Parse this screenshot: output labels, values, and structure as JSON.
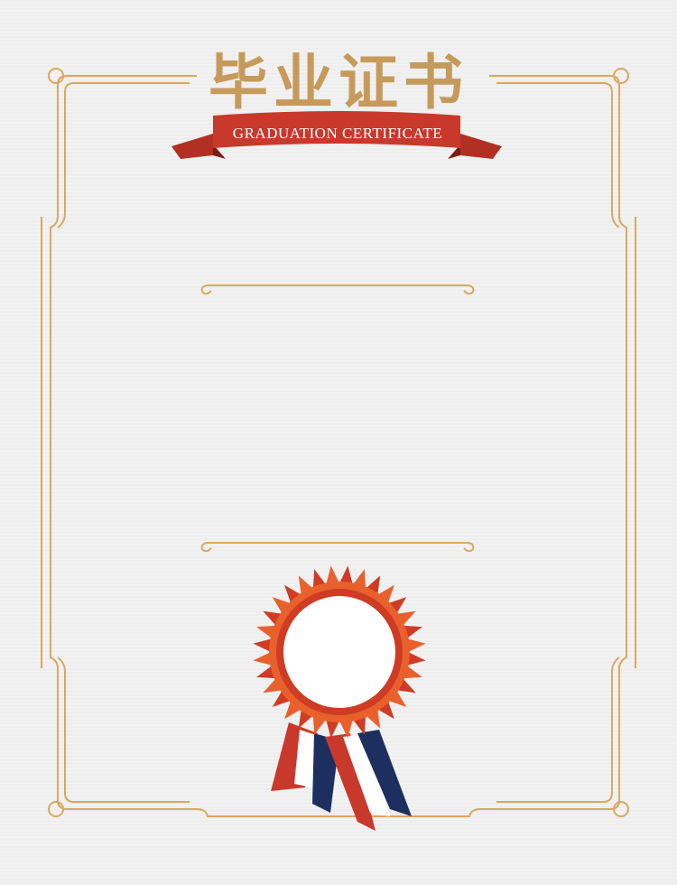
{
  "certificate": {
    "title": "毕业证书",
    "subtitle": "GRADUATION CERTIFICATE"
  },
  "colors": {
    "background": "#eeeeee",
    "frame_gold": "#d9a85f",
    "title_gold": "#c69a5a",
    "ribbon_red": "#c8392b",
    "ribbon_dark": "#8f241b",
    "rosette_orange": "#e8612c",
    "rosette_red": "#cf3b24",
    "ribbon_blue": "#1c2f5e",
    "ribbon_white": "#ffffff"
  }
}
